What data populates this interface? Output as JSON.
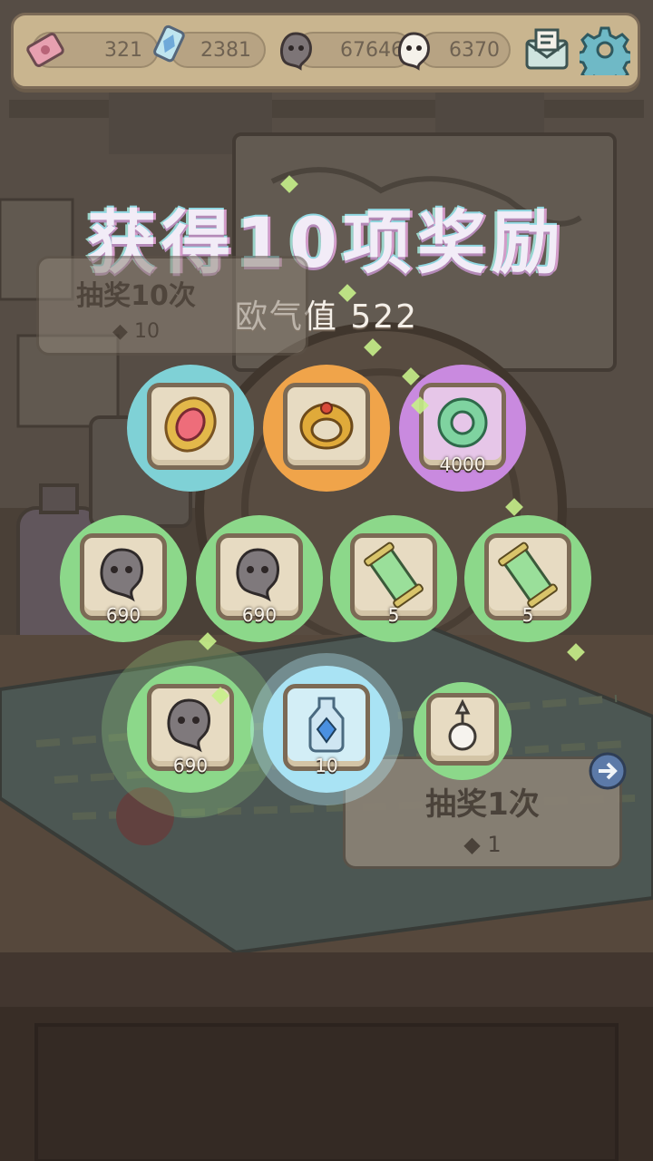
{
  "currency_bar": {
    "tickets": "321",
    "crystals": "2381",
    "dark_souls": "67646",
    "white_souls": "6370"
  },
  "title": "获得10项奖励",
  "luck": {
    "label": "欧气值",
    "value": "522"
  },
  "draw10": {
    "label": "抽奖10次",
    "cost": "10"
  },
  "draw1": {
    "label": "抽奖1次",
    "cost": "1"
  },
  "rewards": [
    {
      "item": "ruby-brooch",
      "color": "#7fd1d6",
      "count": ""
    },
    {
      "item": "gold-ring",
      "color": "#f0a44a",
      "count": ""
    },
    {
      "item": "jade-medallion",
      "color": "#c98adf",
      "count": "4000"
    },
    {
      "item": "dark-soul",
      "color": "#8cd88a",
      "count": "690"
    },
    {
      "item": "dark-soul",
      "color": "#8cd88a",
      "count": "690"
    },
    {
      "item": "green-scroll",
      "color": "#8cd88a",
      "count": "5"
    },
    {
      "item": "green-scroll",
      "color": "#8cd88a",
      "count": "5"
    },
    {
      "item": "dark-soul",
      "color": "#8cd88a",
      "count": "690"
    },
    {
      "item": "crystal-potion",
      "color": "#a9e3f4",
      "count": "10"
    },
    {
      "item": "pearl-pendant",
      "color": "#8cd88a",
      "count": ""
    }
  ]
}
